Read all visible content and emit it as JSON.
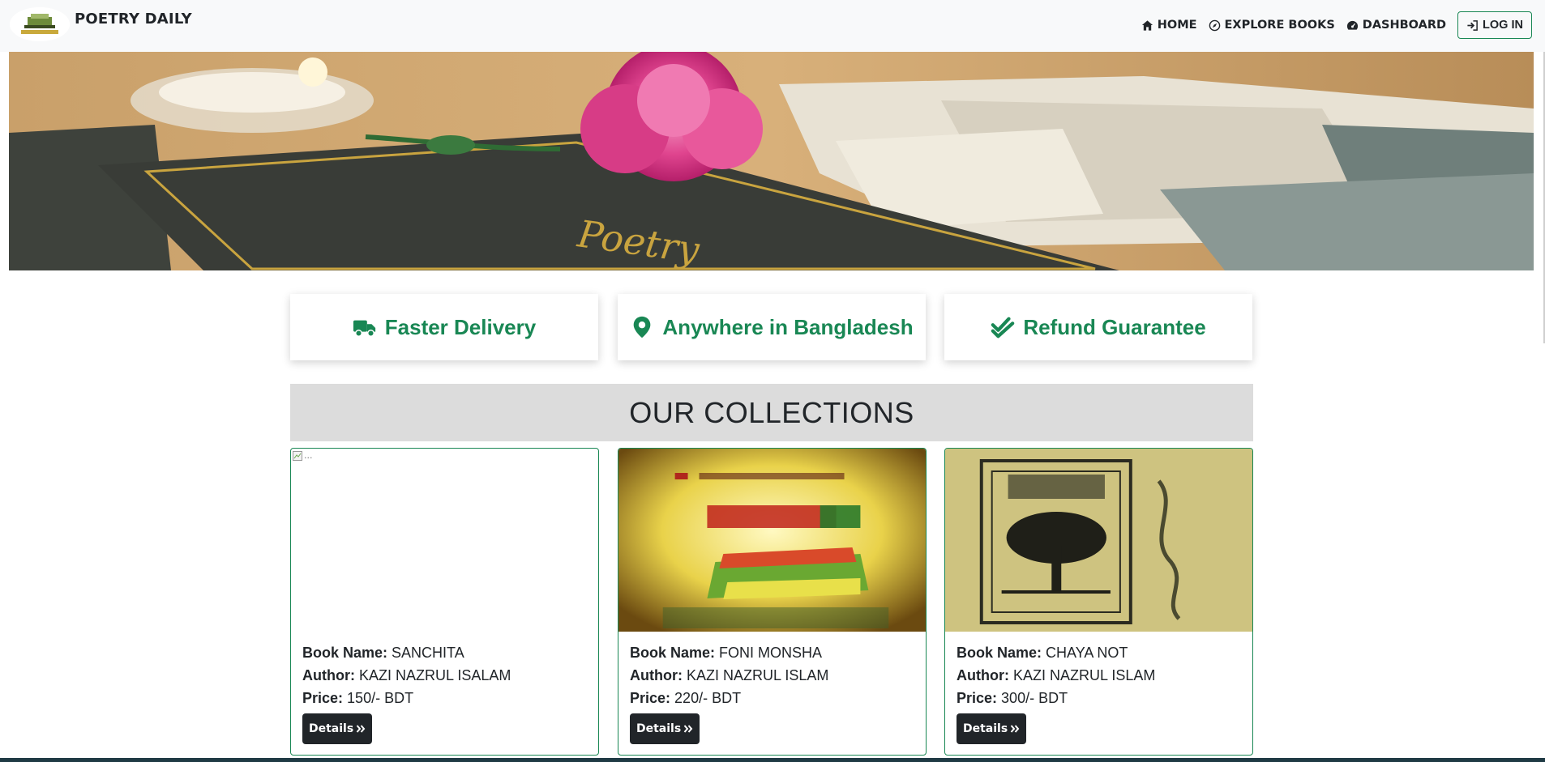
{
  "navbar": {
    "brand_title": "POETRY DAILY",
    "logo_icon": "story-saga-logo",
    "links": [
      {
        "label": "HOME",
        "icon": "home-icon"
      },
      {
        "label": "EXPLORE BOOKS",
        "icon": "compass-icon"
      },
      {
        "label": "DASHBOARD",
        "icon": "gauge-icon"
      }
    ],
    "login_label": "LOG IN",
    "login_icon": "sign-in-icon"
  },
  "features": [
    {
      "label": "Faster Delivery",
      "icon": "truck-icon"
    },
    {
      "label": "Anywhere in Bangladesh",
      "icon": "location-pin-icon"
    },
    {
      "label": "Refund Guarantee",
      "icon": "double-check-icon"
    }
  ],
  "collections": {
    "title": "OUR COLLECTIONS",
    "labels": {
      "book_name": "Book Name:",
      "author": "Author:",
      "price": "Price:"
    },
    "details_label": "Details",
    "books": [
      {
        "book_name": "SANCHITA",
        "author": "KAZI NAZRUL ISALAM",
        "price": "150/- BDT",
        "image_alt": "..."
      },
      {
        "book_name": "FONI MONSHA",
        "author": "KAZI NAZRUL ISLAM",
        "price": "220/- BDT"
      },
      {
        "book_name": "CHAYA NOT",
        "author": "KAZI NAZRUL ISLAM",
        "price": "300/- BDT"
      }
    ]
  },
  "colors": {
    "accent": "#198754",
    "dark": "#212529",
    "navbar_bg": "#f8f9fa",
    "collections_bg": "#dcdcdc"
  }
}
